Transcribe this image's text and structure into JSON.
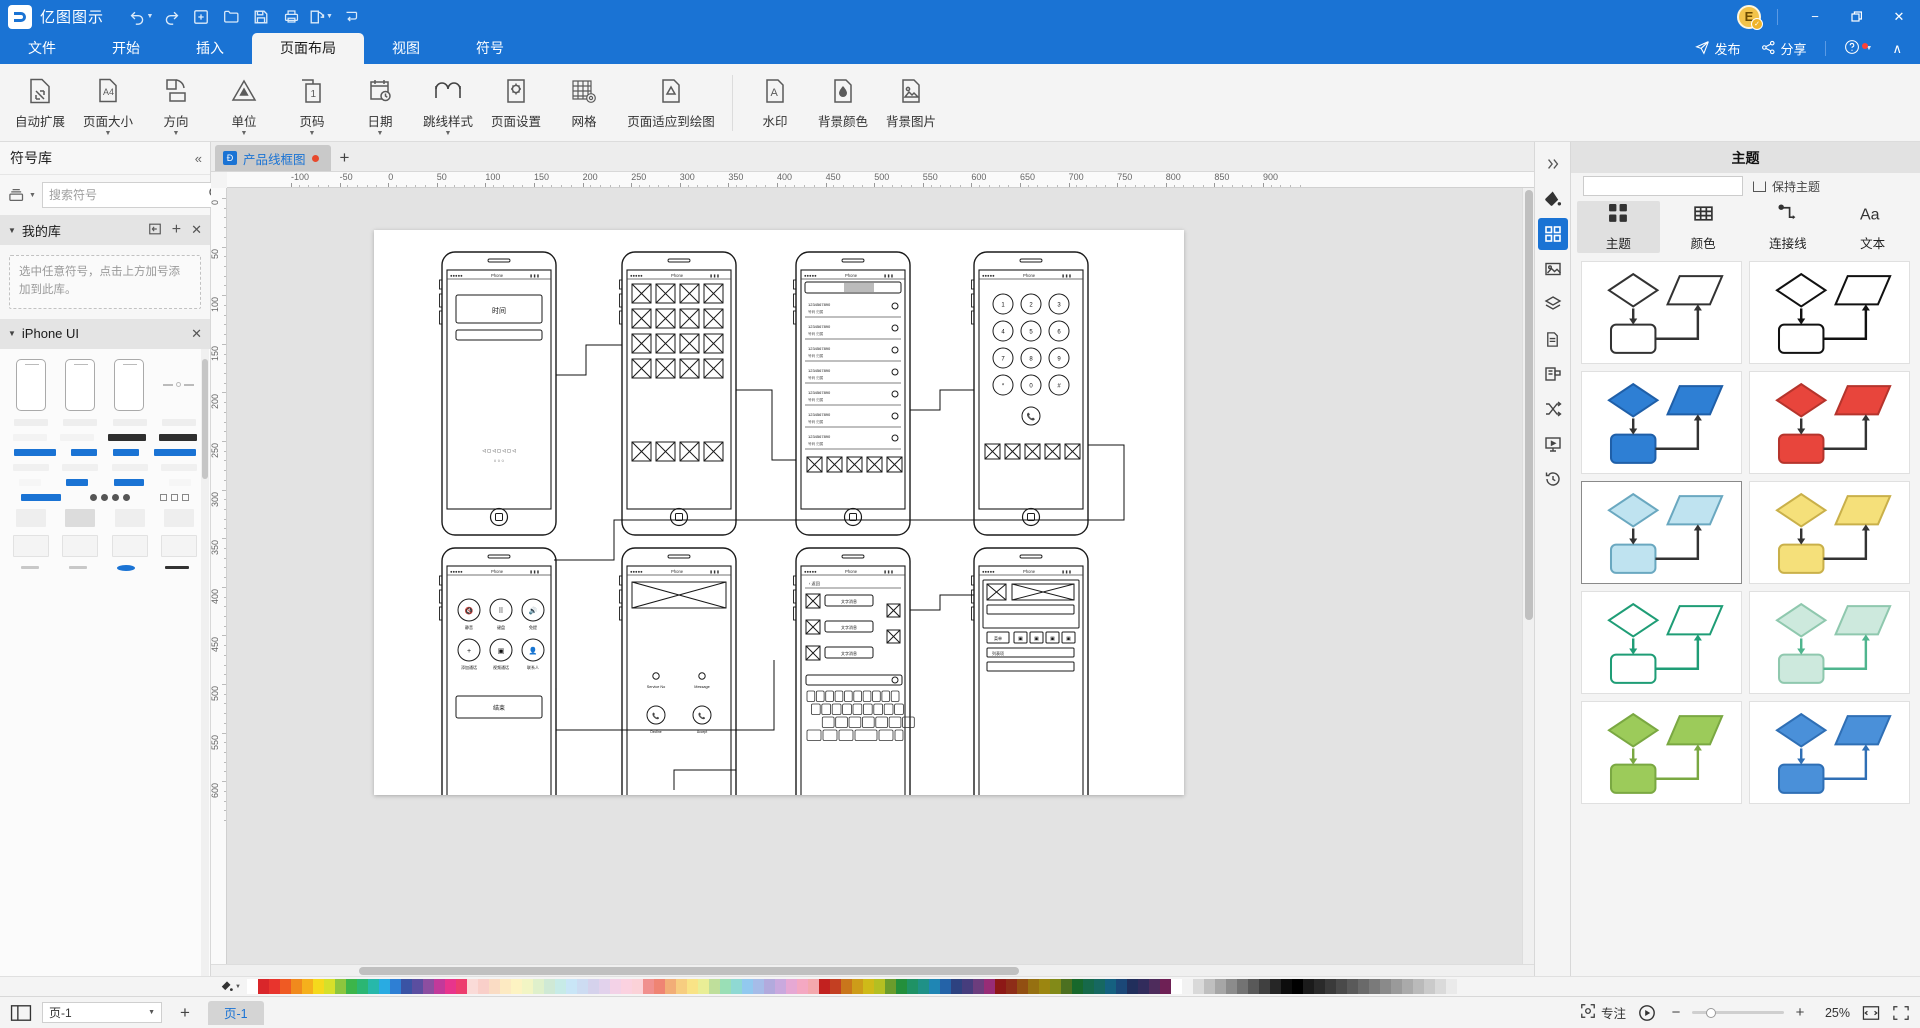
{
  "titlebar": {
    "app_name": "亿图图示",
    "logo_letter": "Ɖ",
    "quick_actions": [
      {
        "name": "undo-button",
        "glyph": "↶",
        "has_caret": true
      },
      {
        "name": "redo-button",
        "glyph": "↷",
        "has_caret": false
      },
      {
        "name": "new-button",
        "glyph": "+",
        "has_caret": false
      },
      {
        "name": "open-button",
        "glyph": "open",
        "has_caret": false
      },
      {
        "name": "save-button",
        "glyph": "save",
        "has_caret": false
      },
      {
        "name": "print-button",
        "glyph": "print",
        "has_caret": false
      },
      {
        "name": "export-button",
        "glyph": "export",
        "has_caret": true
      },
      {
        "name": "customize-button",
        "glyph": "↴",
        "has_caret": false
      }
    ],
    "avatar_letter": "E",
    "minimize": "−",
    "restore": "❐",
    "close": "✕"
  },
  "menubar": {
    "tabs": [
      {
        "label": "文件",
        "active": false
      },
      {
        "label": "开始",
        "active": false
      },
      {
        "label": "插入",
        "active": false
      },
      {
        "label": "页面布局",
        "active": true
      },
      {
        "label": "视图",
        "active": false
      },
      {
        "label": "符号",
        "active": false
      }
    ],
    "publish_label": "发布",
    "share_label": "分享",
    "help_label": "?",
    "collapse_label": "∧"
  },
  "ribbon": {
    "groups": [
      {
        "items": [
          {
            "label": "自动扩展",
            "icon": "auto-expand-icon",
            "dropdown": false
          },
          {
            "label": "页面大小",
            "icon": "page-size-icon",
            "dropdown": true
          },
          {
            "label": "方向",
            "icon": "orientation-icon",
            "dropdown": true
          },
          {
            "label": "单位",
            "icon": "unit-icon",
            "dropdown": true
          },
          {
            "label": "页码",
            "icon": "page-number-icon",
            "dropdown": true
          },
          {
            "label": "日期",
            "icon": "date-icon",
            "dropdown": true
          },
          {
            "label": "跳线样式",
            "icon": "jumpline-style-icon",
            "dropdown": true
          },
          {
            "label": "页面设置",
            "icon": "page-setup-icon",
            "dropdown": false
          },
          {
            "label": "网格",
            "icon": "grid-icon",
            "dropdown": false
          },
          {
            "label": "页面适应到绘图",
            "icon": "fit-page-to-drawing-icon",
            "dropdown": false
          }
        ]
      },
      {
        "items": [
          {
            "label": "水印",
            "icon": "watermark-icon",
            "dropdown": false
          },
          {
            "label": "背景颜色",
            "icon": "background-color-icon",
            "dropdown": false
          },
          {
            "label": "背景图片",
            "icon": "background-image-icon",
            "dropdown": false
          }
        ]
      }
    ]
  },
  "left_panel": {
    "title": "符号库",
    "collapse_icon": "chevrons-left-icon",
    "search_placeholder": "搜索符号",
    "search_value": "",
    "library_button": "library-dropdown-button",
    "sections": [
      {
        "name": "我的库",
        "expanded": true,
        "hint": "选中任意符号，点击上方加号添加到此库。",
        "actions": [
          "import-icon",
          "add-icon",
          "close-icon"
        ]
      },
      {
        "name": "iPhone UI",
        "expanded": true,
        "actions": [
          "close-icon"
        ]
      }
    ]
  },
  "doc_tabs": {
    "tabs": [
      {
        "label": "产品线框图",
        "dirty": true,
        "active": true
      }
    ],
    "new_tab_label": "+"
  },
  "ruler": {
    "horizontal_unit_labels": [
      "-100",
      "-50",
      "0",
      "50",
      "100",
      "150",
      "200",
      "250",
      "300",
      "350",
      "400",
      "450",
      "500",
      "550",
      "600",
      "650",
      "700",
      "750",
      "800",
      "850",
      "900"
    ],
    "vertical_unit_labels": [
      "0",
      "50",
      "100",
      "150",
      "200",
      "250",
      "300",
      "350",
      "400",
      "450",
      "500",
      "550",
      "600"
    ]
  },
  "canvas": {
    "page_label": "产品线框图",
    "wireframes": [
      {
        "name": "login-screen",
        "caption_button": "时间"
      },
      {
        "name": "grid-gallery-screen"
      },
      {
        "name": "contact-list-screen"
      },
      {
        "name": "dialpad-screen"
      },
      {
        "name": "in-call-screen",
        "action_label": "结束"
      },
      {
        "name": "incoming-call-screen",
        "left_label": "Service No",
        "right_label": "Message"
      },
      {
        "name": "chat-keyboard-screen"
      },
      {
        "name": "media-player-screen"
      }
    ]
  },
  "rail": {
    "buttons": [
      {
        "name": "expand-panel-button",
        "icon": "chevrons-right-icon",
        "active": false
      },
      {
        "name": "fill-tool-button",
        "icon": "paint-bucket-icon",
        "active": false
      },
      {
        "name": "theme-panel-button",
        "icon": "theme-grid-icon",
        "active": true
      },
      {
        "name": "image-panel-button",
        "icon": "image-icon",
        "active": false
      },
      {
        "name": "layers-panel-button",
        "icon": "layers-icon",
        "active": false
      },
      {
        "name": "pages-panel-button",
        "icon": "document-icon",
        "active": false
      },
      {
        "name": "container-panel-button",
        "icon": "container-icon",
        "active": false
      },
      {
        "name": "shuffle-panel-button",
        "icon": "shuffle-icon",
        "active": false
      },
      {
        "name": "presentation-panel-button",
        "icon": "presentation-icon",
        "active": false
      },
      {
        "name": "history-panel-button",
        "icon": "history-icon",
        "active": false
      }
    ]
  },
  "right_panel": {
    "title": "主题",
    "keep_theme_label": "保持主题",
    "keep_theme_checked": false,
    "combo_value": "",
    "tabs": [
      {
        "label": "主题",
        "icon": "theme-grid-icon",
        "active": true
      },
      {
        "label": "颜色",
        "icon": "color-table-icon",
        "active": false
      },
      {
        "label": "连接线",
        "icon": "connector-icon",
        "active": false
      },
      {
        "label": "文本",
        "icon": "text-icon",
        "active": false
      }
    ],
    "themes": [
      {
        "name": "theme-white",
        "selected": false,
        "shape_fill": "#ffffff",
        "shape_stroke": "#333333",
        "arrow": "#333333"
      },
      {
        "name": "theme-black-outline",
        "selected": false,
        "shape_fill": "#ffffff",
        "shape_stroke": "#111111",
        "arrow": "#111111"
      },
      {
        "name": "theme-blue",
        "selected": false,
        "shape_fill": "#2e7fd4",
        "shape_stroke": "#1f5fa8",
        "arrow": "#333333"
      },
      {
        "name": "theme-red",
        "selected": false,
        "shape_fill": "#e8453c",
        "shape_stroke": "#b5342c",
        "arrow": "#333333"
      },
      {
        "name": "theme-light-blue",
        "selected": true,
        "shape_fill": "#bfe3f0",
        "shape_stroke": "#6aa8c0",
        "arrow": "#333333"
      },
      {
        "name": "theme-yellow",
        "selected": false,
        "shape_fill": "#f5e07a",
        "shape_stroke": "#c9b04a",
        "arrow": "#333333"
      },
      {
        "name": "theme-green-outline",
        "selected": false,
        "shape_fill": "#ffffff",
        "shape_stroke": "#1f9d76",
        "arrow": "#1f9d76"
      },
      {
        "name": "theme-mint",
        "selected": false,
        "shape_fill": "#cde9dd",
        "shape_stroke": "#8fc8ae",
        "arrow": "#4fb58e"
      },
      {
        "name": "theme-olive",
        "selected": false,
        "shape_fill": "#9ccb5a",
        "shape_stroke": "#7aa842",
        "arrow": "#7aa842"
      },
      {
        "name": "theme-steel-blue",
        "selected": false,
        "shape_fill": "#4a90d9",
        "shape_stroke": "#2f6fb5",
        "arrow": "#2f6fb5"
      }
    ]
  },
  "status_bar": {
    "view_icon": "page-view-icon",
    "page_selector_value": "页-1",
    "add_page_label": "+",
    "page_tab_label": "页-1",
    "focus_label": "专注",
    "focus_icon": "focus-icon",
    "play_icon": "presentation-play-icon",
    "zoom_out": "−",
    "zoom_in": "+",
    "zoom_percent": "25%",
    "fit_page_icon": "fit-page-icon",
    "full_screen_icon": "full-screen-icon"
  },
  "palette": {
    "colors": [
      "#ffffff",
      "#d9262a",
      "#e8342d",
      "#ef5a23",
      "#f08a1d",
      "#f5b01c",
      "#f5d91c",
      "#d6e02a",
      "#8cc63e",
      "#3cb54a",
      "#2bb673",
      "#27b8aa",
      "#29abe2",
      "#2e7fd4",
      "#3a53a4",
      "#5b4ea0",
      "#8c4ea0",
      "#c2399a",
      "#e8348c",
      "#ed3d6e",
      "#fadbd8",
      "#f9cfc9",
      "#fadcc4",
      "#fdeac2",
      "#fdf3c2",
      "#f2f5c4",
      "#dff0cb",
      "#cfe9d5",
      "#c7ebe7",
      "#c9e6f7",
      "#cddcf2",
      "#d5d2ec",
      "#e2d2ec",
      "#f3d2e7",
      "#fbd2e0",
      "#fbd2d8",
      "#f0908e",
      "#ef8473",
      "#f2ad77",
      "#f7cd80",
      "#f9e386",
      "#e9ee96",
      "#bfdf9b",
      "#9adfb6",
      "#8fd9d3",
      "#92c9ef",
      "#a6bce8",
      "#b2aadd",
      "#c9a9de",
      "#e6a8d4",
      "#f4a8c2",
      "#f4a8ad",
      "#c2211f",
      "#c33f22",
      "#c9761b",
      "#cd9c19",
      "#cfba18",
      "#b4bf22",
      "#6a9c2c",
      "#238f3b",
      "#1f9265",
      "#1f9187",
      "#1f86b4",
      "#2463a8",
      "#2d4280",
      "#463d7d",
      "#6c3d7d",
      "#982c76",
      "#8d1816",
      "#8e2d18",
      "#924f12",
      "#967011",
      "#9c8610",
      "#828a18",
      "#4c7020",
      "#18682b",
      "#16694a",
      "#166861",
      "#156180",
      "#1b4878",
      "#212f5c",
      "#322c5c",
      "#4e2c5c",
      "#6e2055",
      "#ffffff",
      "#f2f2f2",
      "#d9d9d9",
      "#bfbfbf",
      "#a6a6a6",
      "#8c8c8c",
      "#737373",
      "#595959",
      "#404040",
      "#262626",
      "#0d0d0d",
      "#000000",
      "#1b1b1b",
      "#2a2a2a",
      "#3a3a3a",
      "#4a4a4a",
      "#5a5a5a",
      "#6a6a6a",
      "#7a7a7a",
      "#8a8a8a",
      "#9a9a9a",
      "#aaaaaa",
      "#bababa",
      "#cacaca",
      "#dadada",
      "#eaeaea"
    ]
  }
}
